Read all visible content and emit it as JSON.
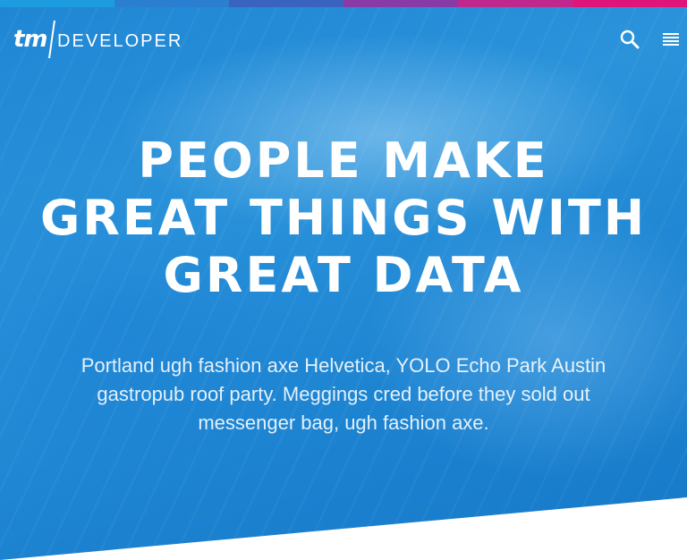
{
  "colors": {
    "top_bar": [
      "#1e9ce0",
      "#2a7fd1",
      "#3a63bf",
      "#8a3aa6",
      "#c0288d",
      "#e0157a"
    ],
    "hero_blue": "#1f86d4",
    "text": "#ffffff"
  },
  "header": {
    "logo": {
      "mark": "tm",
      "word": "DEVELOPER"
    },
    "icons": [
      "search-icon",
      "menu-icon"
    ]
  },
  "hero": {
    "title": "PEOPLE MAKE GREAT THINGS WITH GREAT DATA",
    "text": "Portland ugh fashion axe Helvetica, YOLO Echo Park Austin gastropub roof party. Meggings cred before they sold out messenger bag, ugh fashion axe."
  }
}
